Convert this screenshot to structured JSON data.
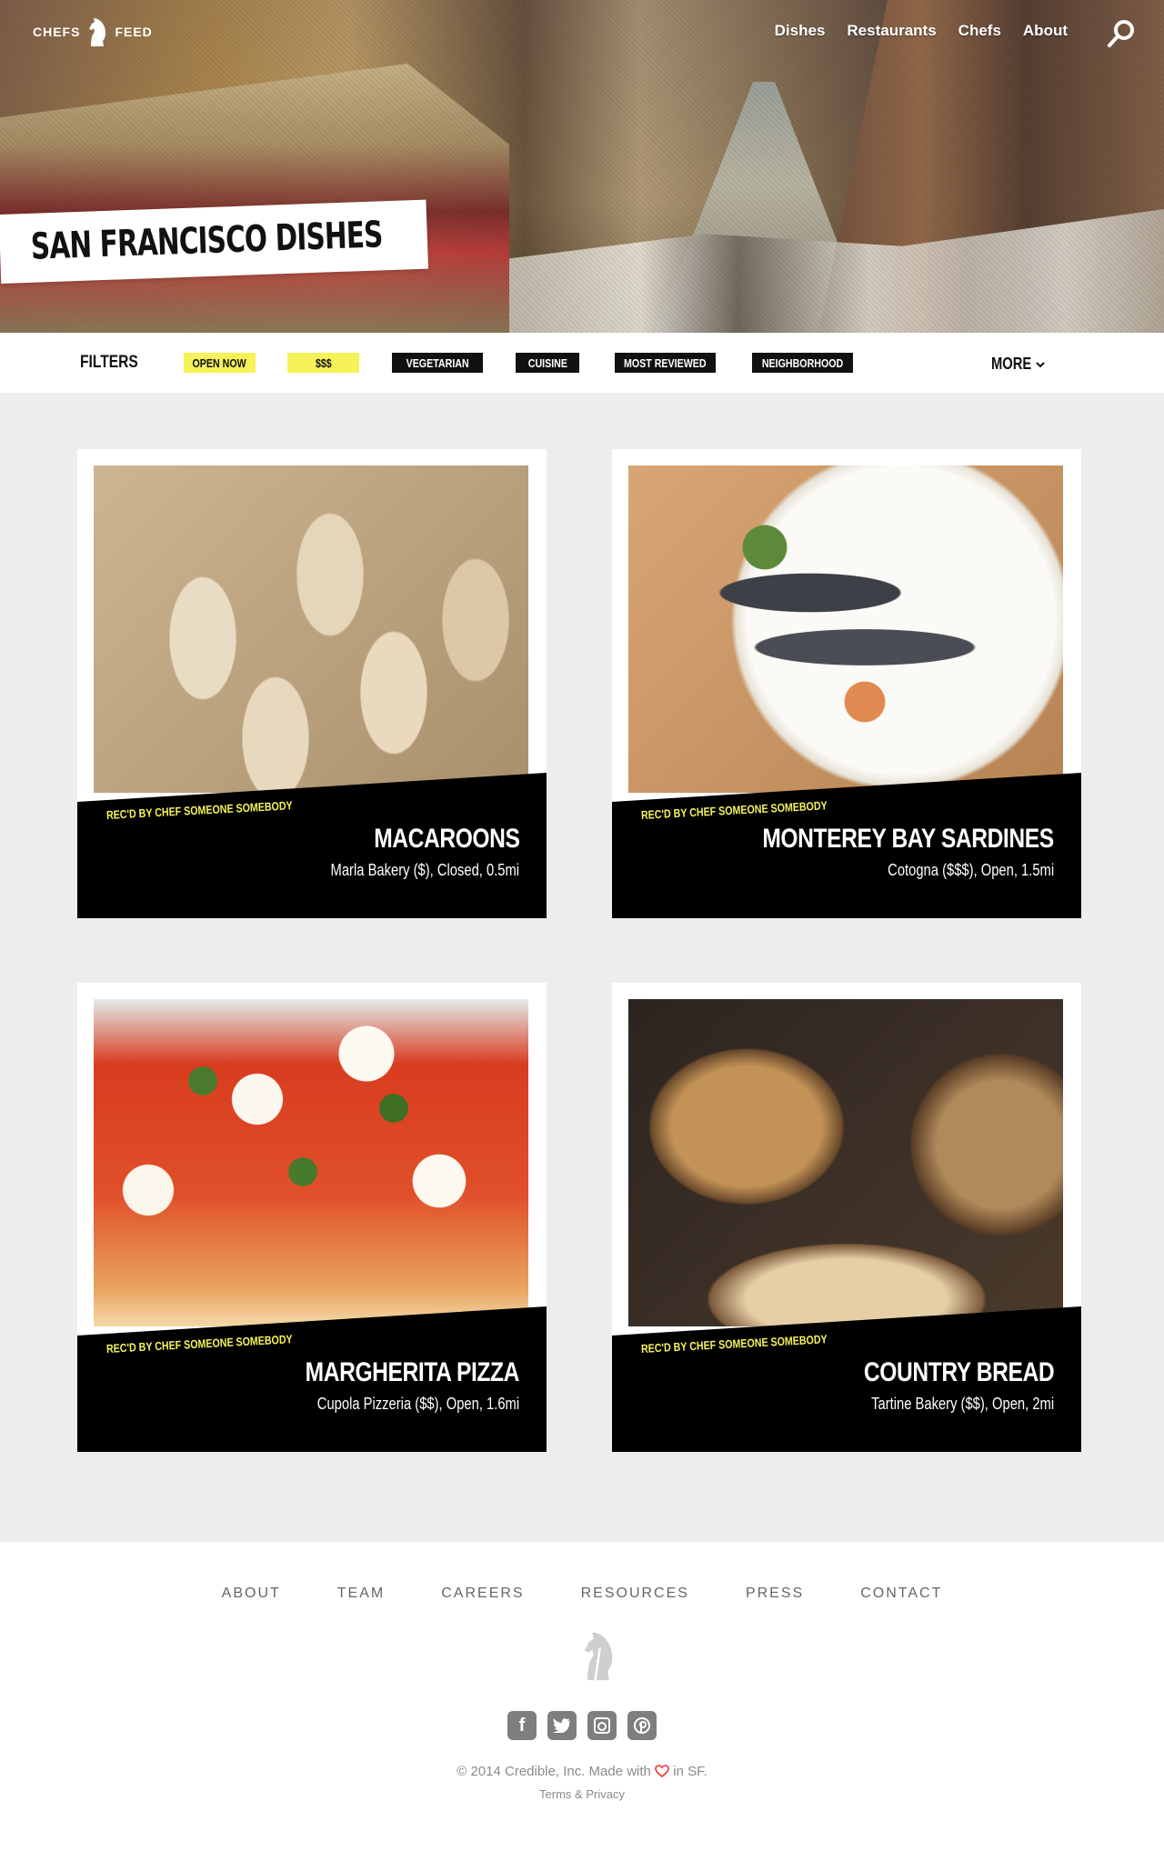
{
  "brand": {
    "left": "CHEFS",
    "right": "FEED"
  },
  "nav": [
    "Dishes",
    "Restaurants",
    "Chefs",
    "About"
  ],
  "hero_title": "SAN FRANCISCO DISHES",
  "filters": {
    "label": "FILTERS",
    "chips": [
      {
        "label": "OPEN NOW",
        "style": "yellow"
      },
      {
        "label": "$$$",
        "style": "yellow"
      },
      {
        "label": "VEGETARIAN",
        "style": "black"
      },
      {
        "label": "CUISINE",
        "style": "black"
      },
      {
        "label": "MOST REVIEWED",
        "style": "black"
      },
      {
        "label": "NEIGHBORHOOD",
        "style": "black"
      }
    ],
    "more": "MORE"
  },
  "dishes": [
    {
      "rec": "REC'D BY CHEF SOMEONE SOMEBODY",
      "name": "MACAROONS",
      "meta": "Marla Bakery ($), Closed, 0.5mi",
      "photo": "macaroons"
    },
    {
      "rec": "REC'D BY CHEF SOMEONE SOMEBODY",
      "name": "MONTEREY BAY SARDINES",
      "meta": "Cotogna ($$$), Open, 1.5mi",
      "photo": "sardines"
    },
    {
      "rec": "REC'D BY CHEF SOMEONE SOMEBODY",
      "name": "MARGHERITA PIZZA",
      "meta": "Cupola Pizzeria ($$), Open, 1.6mi",
      "photo": "pizza"
    },
    {
      "rec": "REC'D BY CHEF SOMEONE SOMEBODY",
      "name": "COUNTRY BREAD",
      "meta": "Tartine Bakery ($$), Open, 2mi",
      "photo": "bread"
    }
  ],
  "footer": {
    "links": [
      "ABOUT",
      "TEAM",
      "CAREERS",
      "RESOURCES",
      "PRESS",
      "CONTACT"
    ],
    "social": [
      "facebook-icon",
      "twitter-icon",
      "instagram-icon",
      "pinterest-icon"
    ],
    "copyright_pre": "© 2014 Credible, Inc. Made with",
    "copyright_post": "in SF.",
    "terms": "Terms & Privacy"
  },
  "colors": {
    "accent_yellow": "#f6f25a",
    "black": "#111111",
    "heart": "#e33333"
  }
}
